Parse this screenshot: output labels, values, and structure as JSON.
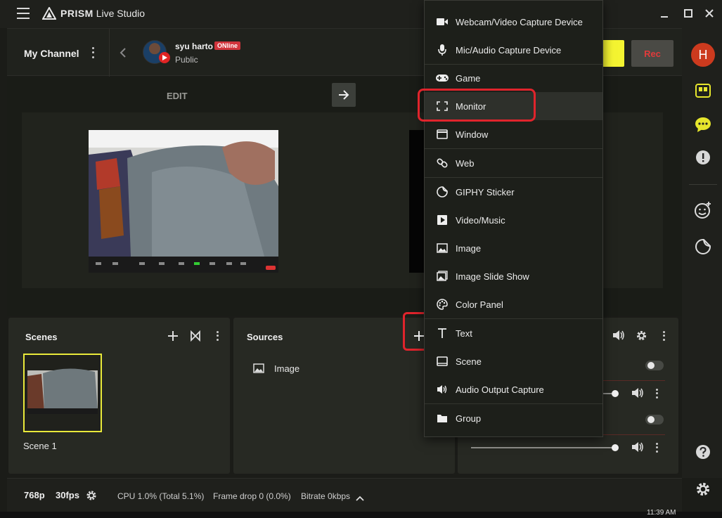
{
  "app": {
    "brand": "PRISM",
    "title_suffix": "Live Studio"
  },
  "header": {
    "channel_label": "My Channel",
    "user_name": "syu harto",
    "online_badge": "ONline",
    "privacy": "Public",
    "rec_label": "Rec"
  },
  "preview": {
    "edit_label": "EDIT"
  },
  "scenes": {
    "title": "Scenes",
    "items": [
      {
        "label": "Scene 1"
      }
    ]
  },
  "sources": {
    "title": "Sources",
    "items": [
      {
        "label": "Image"
      }
    ]
  },
  "source_menu": {
    "items": [
      {
        "label": "Webcam/Video Capture Device",
        "icon": "webcam-icon"
      },
      {
        "label": "Mic/Audio Capture Device",
        "icon": "mic-icon"
      },
      {
        "label": "Game",
        "icon": "gamepad-icon"
      },
      {
        "label": "Monitor",
        "icon": "monitor-icon"
      },
      {
        "label": "Window",
        "icon": "window-icon"
      },
      {
        "label": "Web",
        "icon": "link-icon"
      },
      {
        "label": "GIPHY Sticker",
        "icon": "sticker-icon"
      },
      {
        "label": "Video/Music",
        "icon": "play-icon"
      },
      {
        "label": "Image",
        "icon": "image-icon"
      },
      {
        "label": "Image Slide Show",
        "icon": "slideshow-icon"
      },
      {
        "label": "Color Panel",
        "icon": "palette-icon"
      },
      {
        "label": "Text",
        "icon": "text-icon"
      },
      {
        "label": "Scene",
        "icon": "scene-icon"
      },
      {
        "label": "Audio Output Capture",
        "icon": "speaker-icon"
      },
      {
        "label": "Group",
        "icon": "folder-icon"
      }
    ],
    "highlighted": "Monitor"
  },
  "status": {
    "resolution": "768p",
    "fps": "30fps",
    "cpu": "CPU 1.0% (Total 5.1%)",
    "frame_drop": "Frame drop 0 (0.0%)",
    "bitrate": "Bitrate 0kbps"
  },
  "taskbar": {
    "clock": "11:39 AM"
  },
  "colors": {
    "accent_yellow": "#f4f431",
    "rec_red": "#e03b3b",
    "highlight_red": "#e0242c",
    "avatar_orange": "#cc3a1e"
  }
}
